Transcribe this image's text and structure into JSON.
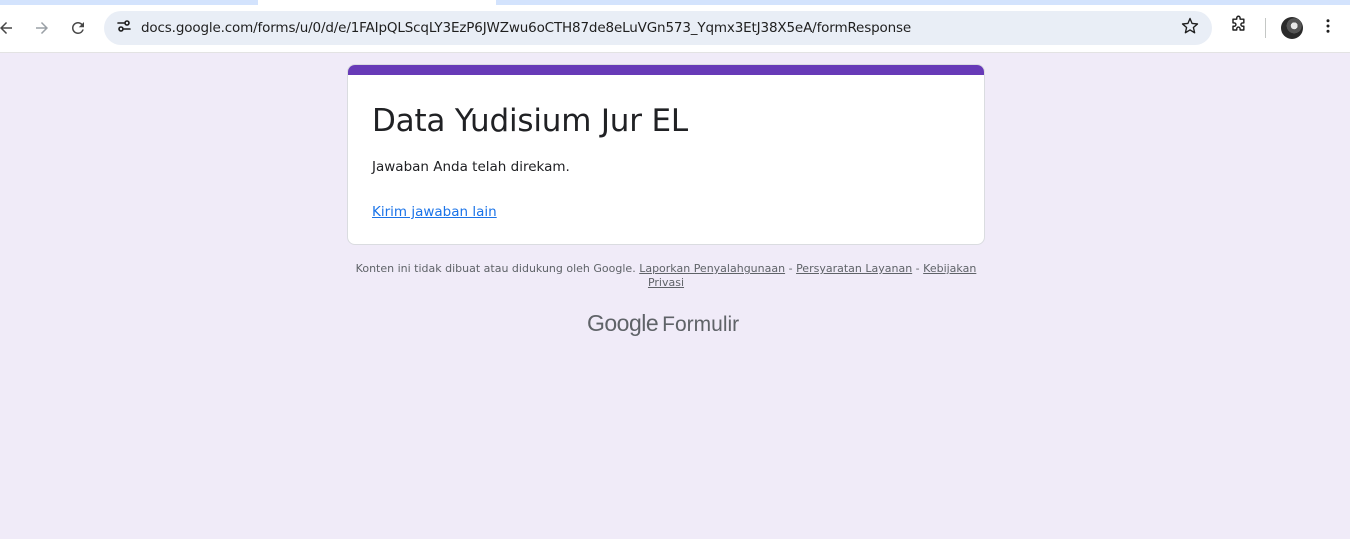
{
  "browser": {
    "url": "docs.google.com/forms/u/0/d/e/1FAIpQLScqLY3EzP6JWZwu6oCTH87de8eLuVGn573_Yqmx3EtJ38X5eA/formResponse",
    "icons": [
      "back-icon",
      "forward-icon",
      "reload-icon",
      "site-info-icon",
      "star-icon",
      "extensions-icon",
      "avatar",
      "more-vert-icon"
    ]
  },
  "form": {
    "title": "Data Yudisium Jur EL",
    "confirmation": "Jawaban Anda telah direkam.",
    "submit_another": "Kirim jawaban lain",
    "accent_color": "#673ab7"
  },
  "footer": {
    "disclaimer": "Konten ini tidak dibuat atau didukung oleh Google.",
    "abuse_link": "Laporkan Penyalahgunaan",
    "separator": "-",
    "terms_link": "Persyaratan Layanan",
    "privacy_link": "Kebijakan Privasi",
    "brand_google": "Google",
    "brand_product": "Formulir"
  },
  "colors": {
    "page_background": "#f0ebf8",
    "link": "#1a73e8"
  }
}
